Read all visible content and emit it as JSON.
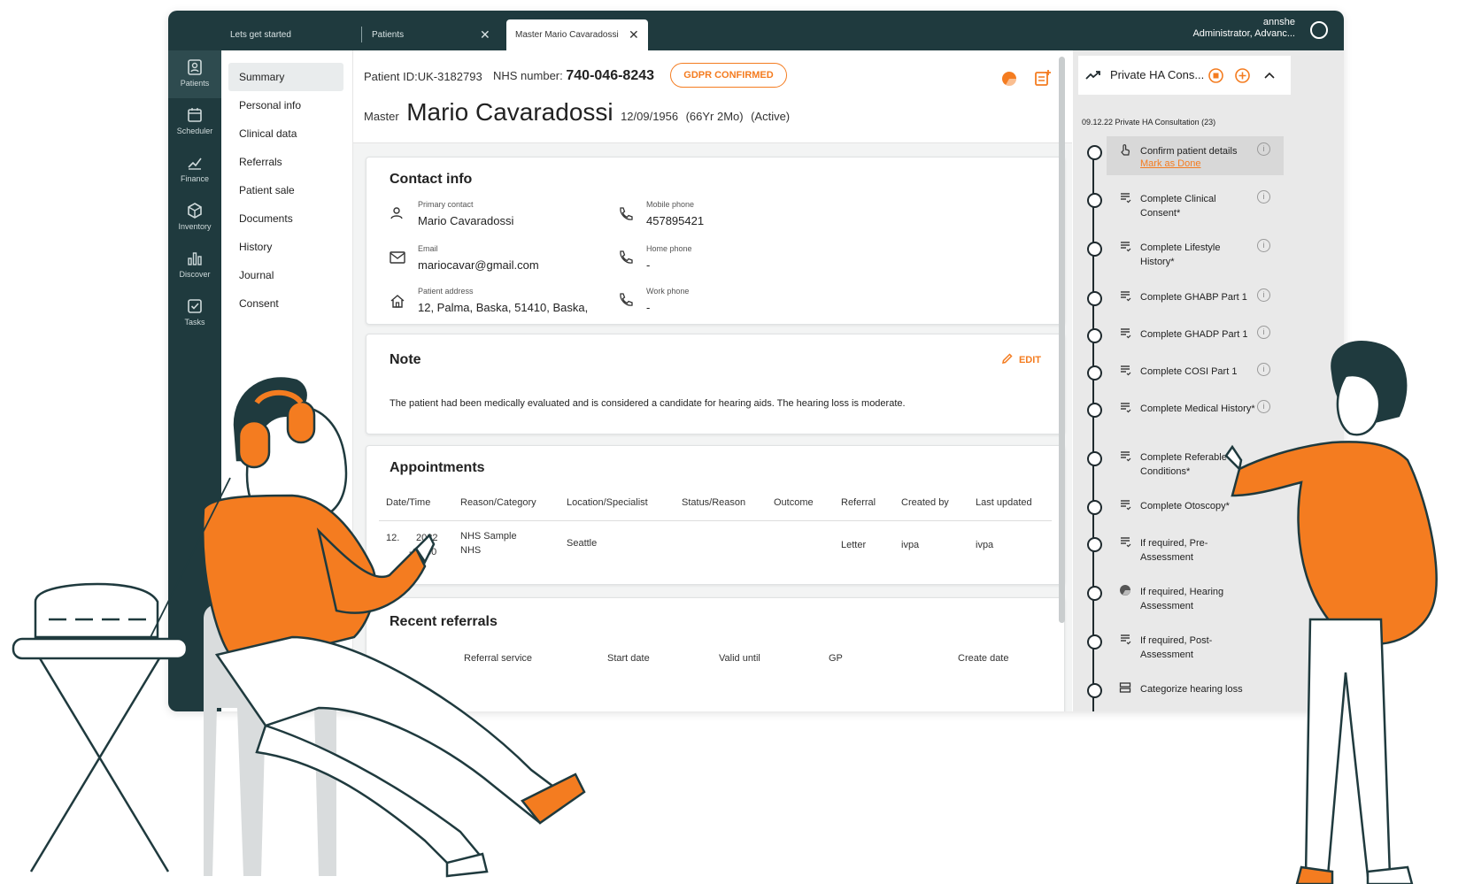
{
  "tabs": [
    {
      "label": "Lets get started"
    },
    {
      "label": "Patients"
    },
    {
      "label": "Master Mario Cavaradossi"
    }
  ],
  "user": {
    "name": "annshe",
    "role": "Administrator, Advanc..."
  },
  "leftnav": [
    "Patients",
    "Scheduler",
    "Finance",
    "Inventory",
    "Discover",
    "Tasks"
  ],
  "submenu": [
    "Summary",
    "Personal info",
    "Clinical data",
    "Referrals",
    "Patient sale",
    "Documents",
    "History",
    "Journal",
    "Consent"
  ],
  "patient": {
    "id_label": "Patient ID:",
    "id": "UK-3182793",
    "nhs_label": "NHS number:",
    "nhs": "740-046-8243",
    "gdpr": "GDPR CONFIRMED",
    "title": "Master",
    "name": "Mario Cavaradossi",
    "dob": "12/09/1956",
    "age": "(66Yr 2Mo)",
    "status": "(Active)"
  },
  "contact": {
    "title": "Contact info",
    "primary_label": "Primary contact",
    "primary": "Mario Cavaradossi",
    "email_label": "Email",
    "email": "mariocavar@gmail.com",
    "address_label": "Patient address",
    "address": "12, Palma, Baska, 51410, Baska,",
    "mobile_label": "Mobile phone",
    "mobile": "457895421",
    "home_label": "Home phone",
    "home": "-",
    "work_label": "Work phone",
    "work": "-"
  },
  "note": {
    "title": "Note",
    "edit": "EDIT",
    "text": "The patient had been medically evaluated and is considered a candidate for hearing aids. The hearing loss is moderate."
  },
  "appointments": {
    "title": "Appointments",
    "headers": [
      "Date/Time",
      "Reason/Category",
      "Location/Specialist",
      "Status/Reason",
      "Outcome",
      "Referral",
      "Created by",
      "Last updated"
    ],
    "row": {
      "date1": "12.",
      "date2": "2022",
      "time": "-17:30",
      "reason1": "NHS Sample",
      "reason2": "NHS",
      "location": "Seattle",
      "referral": "Letter",
      "created": "ivpa",
      "updated": "ivpa"
    }
  },
  "referrals": {
    "title": "Recent referrals",
    "headers": [
      "Referral service",
      "Start date",
      "Valid until",
      "GP",
      "Create date"
    ]
  },
  "workflow": {
    "title": "Private HA Cons...",
    "subtitle": "09.12.22 Private HA Consultation (23)",
    "mark_done": "Mark as Done",
    "steps": [
      "Confirm patient details",
      "Complete Clinical Consent*",
      "Complete Lifestyle History*",
      "Complete GHABP Part 1",
      "Complete GHADP Part 1",
      "Complete COSI Part 1",
      "Complete Medical History*",
      "Complete Referable Conditions*",
      "Complete Otoscopy*",
      "If required, Pre-Assessment",
      "If required, Hearing Assessment",
      "If required, Post-Assessment",
      "Categorize hearing loss"
    ]
  },
  "colors": {
    "accent": "#f47c20",
    "sidebar": "#1f3a3e",
    "outline": "#1f2a2e"
  }
}
